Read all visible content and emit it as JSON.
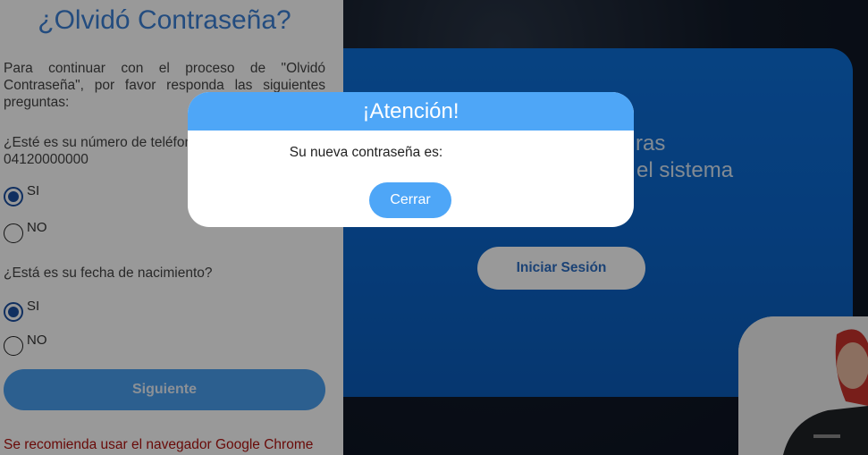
{
  "forgot": {
    "title": "¿Olvidó Contraseña?",
    "intro": "Para continuar con el proceso de \"Olvidó Contraseña\", por favor responda las siguientes preguntas:",
    "q1_text": "¿Esté es su número de teléfono?",
    "q1_value": "04120000000",
    "q1_options": [
      {
        "label": "SI",
        "checked": true
      },
      {
        "label": "NO",
        "checked": false
      }
    ],
    "q2_text": "¿Está es su fecha de nacimiento?",
    "q2_options": [
      {
        "label": "SI",
        "checked": true
      },
      {
        "label": "NO",
        "checked": false
      }
    ],
    "next_label": "Siguiente",
    "browser_note": "Se recomienda usar el navegador Google Chrome"
  },
  "hero": {
    "line1": "ras",
    "line2": "el sistema",
    "login_label": "Iniciar Sesión"
  },
  "modal": {
    "title": "¡Atención!",
    "message": "Su nueva contraseña es:",
    "close_label": "Cerrar"
  },
  "colors": {
    "primary": "#4ea6f7",
    "title_blue": "#3b7fd4",
    "card_blue": "#0b66cc",
    "warning_red": "#b0130f"
  }
}
